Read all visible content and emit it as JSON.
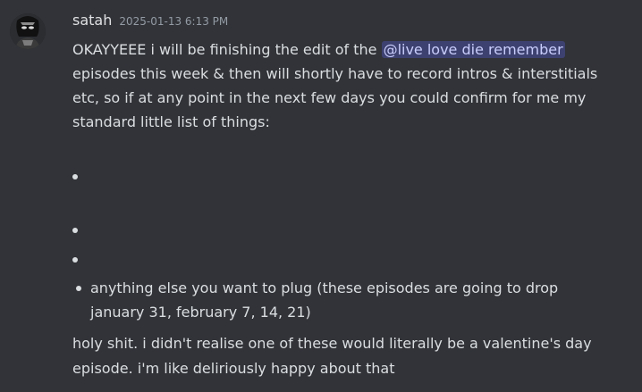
{
  "message": {
    "username": "satah",
    "timestamp": "2025-01-13 6:13 PM",
    "intro_before_mention": "OKAYYEEE i will be finishing the edit of the ",
    "mention": "@live love die remember",
    "intro_after_mention": " episodes this week & then will shortly have to record intros & interstitials etc, so if at any point in the next few days you could confirm for me my standard little list of things:",
    "bullets": [
      "",
      "",
      "",
      "anything else you want to plug (these episodes are going to drop january 31, february 7, 14, 21)"
    ],
    "closing": "holy shit. i didn't realise one of these would literally be a valentine's day episode. i'm like deliriously happy about that"
  },
  "colors": {
    "background": "#313338",
    "text": "#dbdee1",
    "username": "#f2f3f5",
    "timestamp": "#949ba4",
    "mention_bg": "#3c4270",
    "mention_text": "#c9cdfb"
  },
  "avatar_icon": "user-avatar-icon"
}
